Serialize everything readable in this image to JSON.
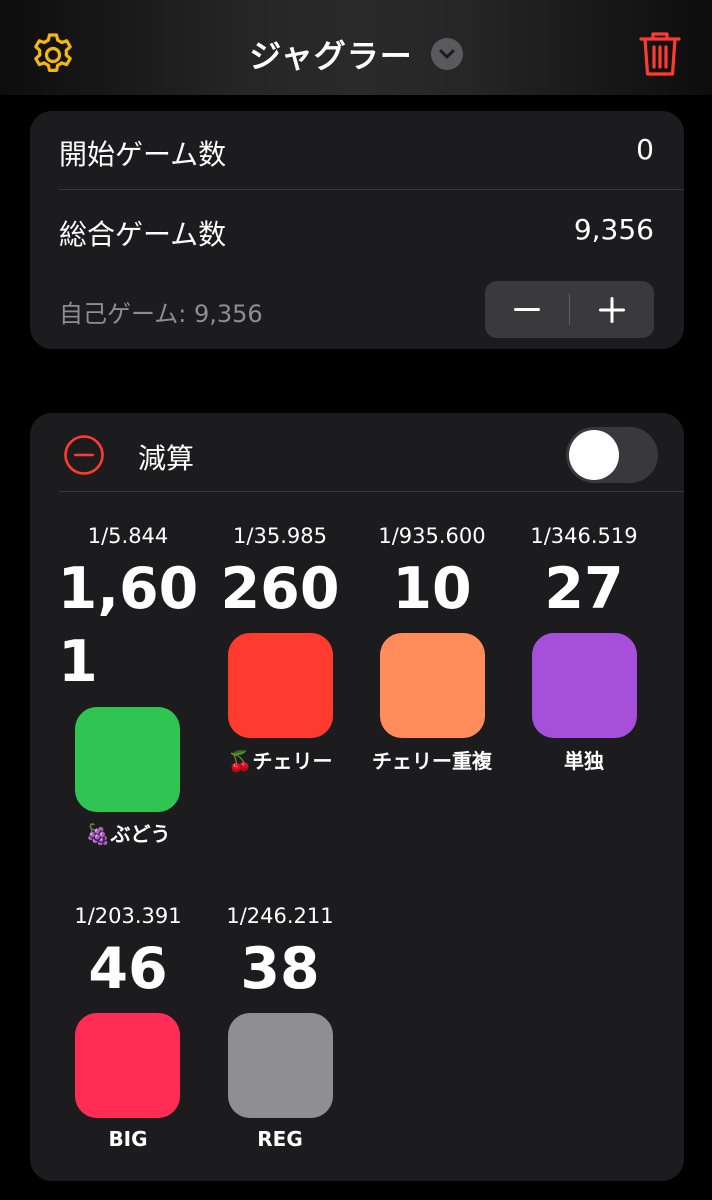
{
  "header": {
    "title": "ジャグラー",
    "settings_icon": "gear-icon",
    "dropdown_icon": "chevron-down-icon",
    "delete_icon": "trash-icon"
  },
  "games": {
    "start_label": "開始ゲーム数",
    "start_value": "0",
    "total_label": "総合ゲーム数",
    "total_value": "9,356",
    "self_label": "自己ゲーム: 9,356",
    "decrement_symbol": "−",
    "increment_symbol": "+"
  },
  "subtract": {
    "label": "減算",
    "toggle_on": false
  },
  "counters": [
    {
      "probability": "1/5.844",
      "count_line1": "1,60",
      "count_line2": "1",
      "label": "🍇ぶどう",
      "color": "#30c553"
    },
    {
      "probability": "1/35.985",
      "count_line1": "260",
      "label": "🍒チェリー",
      "color": "#ff3a2f"
    },
    {
      "probability": "1/935.600",
      "count_line1": "10",
      "label": "チェリー重複",
      "color": "#ff8c5a"
    },
    {
      "probability": "1/346.519",
      "count_line1": "27",
      "label": "単独",
      "color": "#a64fdb"
    },
    {
      "probability": "1/203.391",
      "count_line1": "46",
      "label": "BIG",
      "color": "#ff2d55"
    },
    {
      "probability": "1/246.211",
      "count_line1": "38",
      "label": "REG",
      "color": "#8e8e93"
    }
  ],
  "colors": {
    "accent_yellow": "#f2b90c",
    "accent_red": "#ff3b30",
    "background": "#000000",
    "card": "#1c1c1e"
  }
}
